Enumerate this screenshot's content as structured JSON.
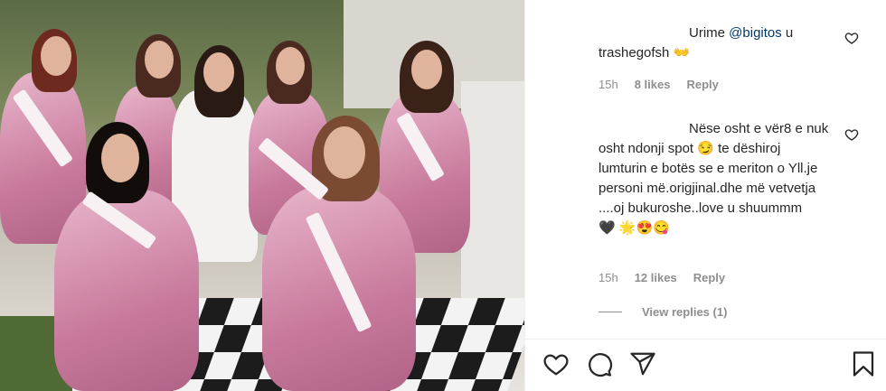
{
  "comments": [
    {
      "text_pre": "Urime ",
      "mention": "@bigitos",
      "text_post": " u trashegofsh",
      "emoji": "👐",
      "time": "15h",
      "likes": "8 likes",
      "reply": "Reply"
    },
    {
      "text": "Nëse osht e vër8 e nuk osht ndonji spot",
      "emoji1": "😏",
      "text2": " te dëshiroj lumturin e botës se e meriton o Yll.je personi më.origjinal.dhe më vetvetja ....oj bukuroshe..love u shuummm",
      "emoji_line": "🖤 🌟😍😋",
      "time": "15h",
      "likes": "12 likes",
      "reply": "Reply"
    }
  ],
  "view_replies": "View replies (1)",
  "icons": {
    "like": "heart-icon",
    "comment": "comment-icon",
    "share": "share-icon",
    "save": "bookmark-icon"
  }
}
